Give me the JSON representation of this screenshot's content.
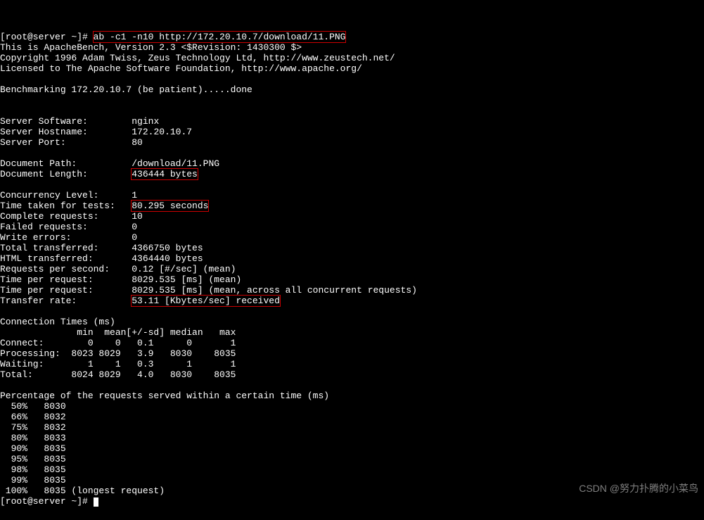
{
  "prompt1": "[root@server ~]# ",
  "cmd": "ab -c1 -n10 http://172.20.10.7/download/11.PNG",
  "headerLines": [
    "This is ApacheBench, Version 2.3 <$Revision: 1430300 $>",
    "Copyright 1996 Adam Twiss, Zeus Technology Ltd, http://www.zeustech.net/",
    "Licensed to The Apache Software Foundation, http://www.apache.org/"
  ],
  "benchLine": "Benchmarking 172.20.10.7 (be patient).....done",
  "k": {
    "serverSoftware": "Server Software:        ",
    "serverHostname": "Server Hostname:        ",
    "serverPort": "Server Port:            ",
    "docPath": "Document Path:          ",
    "docLength": "Document Length:        ",
    "concLevel": "Concurrency Level:      ",
    "timeTaken": "Time taken for tests:   ",
    "completeReq": "Complete requests:      ",
    "failedReq": "Failed requests:        ",
    "writeErr": "Write errors:           ",
    "totalTrans": "Total transferred:      ",
    "htmlTrans": "HTML transferred:       ",
    "rps": "Requests per second:    ",
    "tpr1": "Time per request:       ",
    "tpr2": "Time per request:       ",
    "transferRate": "Transfer rate:          "
  },
  "v": {
    "serverSoftware": "nginx",
    "serverHostname": "172.20.10.7",
    "serverPort": "80",
    "docPath": "/download/11.PNG",
    "docLength": "436444 bytes",
    "concLevel": "1",
    "timeTaken": "80.295 seconds",
    "completeReq": "10",
    "failedReq": "0",
    "writeErr": "0",
    "totalTrans": "4366750 bytes",
    "htmlTrans": "4364440 bytes",
    "rps": "0.12 [#/sec] (mean)",
    "tpr1": "8029.535 [ms] (mean)",
    "tpr2": "8029.535 [ms] (mean, across all concurrent requests)",
    "transferRate": "53.11 [Kbytes/sec] received"
  },
  "connTitle": "Connection Times (ms)",
  "connHeader": "              min  mean[+/-sd] median   max",
  "connRows": [
    "Connect:        0    0   0.1      0       1",
    "Processing:  8023 8029   3.9   8030    8035",
    "Waiting:        1    1   0.3      1       1",
    "Total:       8024 8029   4.0   8030    8035"
  ],
  "pctTitle": "Percentage of the requests served within a certain time (ms)",
  "pctRows": [
    "  50%   8030",
    "  66%   8032",
    "  75%   8032",
    "  80%   8033",
    "  90%   8035",
    "  95%   8035",
    "  98%   8035",
    "  99%   8035",
    " 100%   8035 (longest request)"
  ],
  "prompt2": "[root@server ~]# ",
  "watermark": "CSDN @努力扑腾的小菜鸟"
}
